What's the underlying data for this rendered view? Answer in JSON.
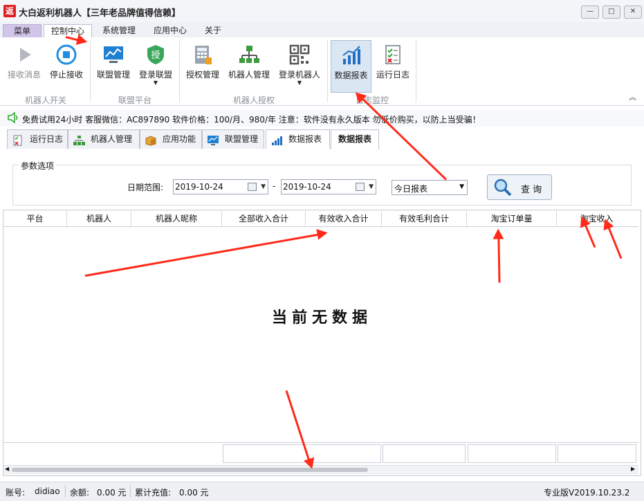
{
  "window": {
    "logo_char": "返",
    "title": "大白返利机器人【三年老品牌值得信赖】",
    "buttons": [
      "—",
      "□",
      "✕"
    ]
  },
  "menu": {
    "tabs": [
      "菜单",
      "控制中心",
      "系统管理",
      "应用中心",
      "关于"
    ]
  },
  "ribbon": {
    "buttons": [
      "接收消息",
      "停止接收",
      "联盟管理",
      "登录联盟",
      "授权管理",
      "机器人管理",
      "登录机器人",
      "数据报表",
      "运行日志"
    ],
    "groups": [
      "机器人开关",
      "联盟平台",
      "机器人授权",
      "日志监控"
    ],
    "collapse_glyph": "︽"
  },
  "notice": {
    "text": "免费试用24小时 客服微信：AC897890 软件价格：100/月、980/年 注意：软件没有永久版本 勿低价购买，以防上当受骗！"
  },
  "content_tabs": [
    "运行日志",
    "机器人管理",
    "应用功能",
    "联盟管理",
    "数据报表",
    "数据报表"
  ],
  "params": {
    "title": "参数选项",
    "date_label": "日期范围:",
    "date_from": "2019-10-24",
    "date_to": "2019-10-24",
    "date_dash": "-",
    "report_type": "今日报表",
    "query_label": "查 询"
  },
  "table": {
    "columns": [
      "平台",
      "机器人",
      "机器人昵称",
      "全部收入合计",
      "有效收入合计",
      "有效毛利合计",
      "淘宝订单量",
      "淘宝收入"
    ],
    "empty_text": "当前无数据"
  },
  "status": {
    "account_label": "账号:",
    "account": "didiao",
    "balance_label": "余额:",
    "balance": "0.00 元",
    "recharge_label": "累计充值:",
    "recharge": "0.00 元",
    "version": "专业版V2019.10.23.2"
  }
}
